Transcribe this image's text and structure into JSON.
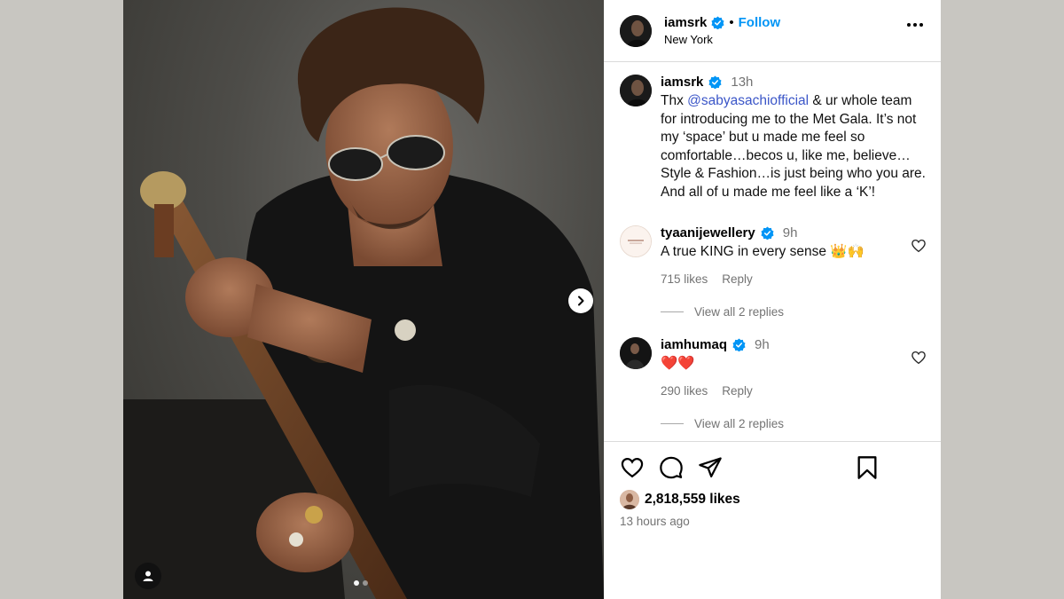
{
  "post": {
    "author": "iamsrk",
    "follow_label": "Follow",
    "separator": "•",
    "location": "New York"
  },
  "caption": {
    "author": "iamsrk",
    "time": "13h",
    "text_before": "Thx ",
    "mention": "@sabyasachiofficial",
    "text_after": " & ur whole team for introducing me to the Met Gala. It’s not my ‘space’ but u made me feel so comfortable…becos u, like me, believe… Style & Fashion…is just being who you are. And all of u made me feel like a ‘K’!"
  },
  "comments": [
    {
      "author": "tyaanijewellery",
      "time": "9h",
      "text": "A true KING in every sense 👑🙌",
      "likes": "715 likes",
      "reply_label": "Reply",
      "view_replies": "View all 2 replies"
    },
    {
      "author": "iamhumaq",
      "time": "9h",
      "text": "❤️❤️",
      "likes": "290 likes",
      "reply_label": "Reply",
      "view_replies": "View all 2 replies"
    }
  ],
  "footer": {
    "likes": "2,818,559 likes",
    "time_ago": "13 hours ago"
  },
  "carousel": {
    "slide_count": 2,
    "current_slide": 1
  },
  "colors": {
    "link": "#0095f6",
    "mention": "#3b56c8",
    "verified": "#0095f6",
    "muted": "#737373"
  },
  "icons": [
    "verified-icon",
    "more-options-icon",
    "heart-icon",
    "comment-icon",
    "share-icon",
    "bookmark-icon",
    "chevron-right-icon",
    "user-tag-icon"
  ]
}
